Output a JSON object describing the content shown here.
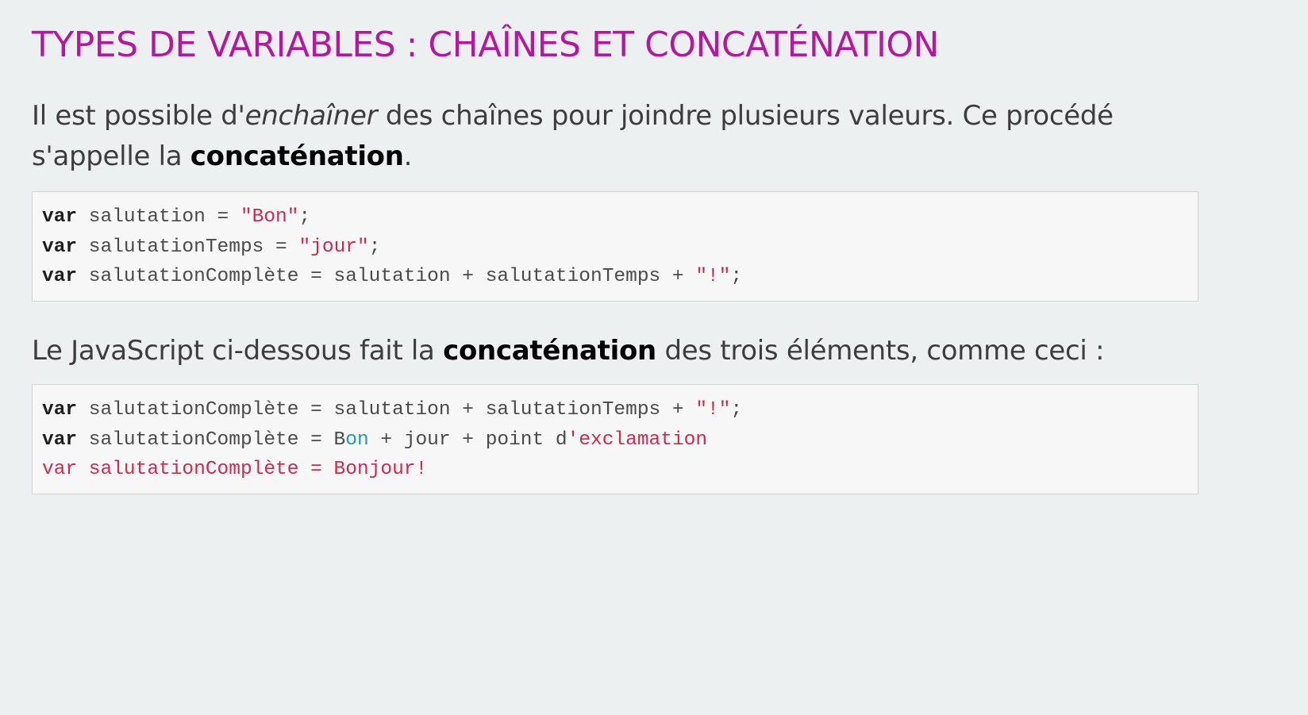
{
  "title": "TYPES DE VARIABLES : CHAÎNES ET CONCATÉNATION",
  "paragraph1": {
    "part1": "Il est possible d'",
    "emphasis": "enchaîner",
    "part2": " des chaînes pour joindre plusieurs valeurs. Ce procédé s'appelle la ",
    "strong": "concaténation",
    "part3": "."
  },
  "code1": {
    "line1": {
      "kw": "var",
      "text": " salutation = ",
      "str": "\"Bon\"",
      "end": ";"
    },
    "line2": {
      "kw": "var",
      "text": " salutationTemps = ",
      "str": "\"jour\"",
      "end": ";"
    },
    "line3": {
      "kw": "var",
      "text": " salutationComplète = salutation + salutationTemps + ",
      "str": "\"!\"",
      "end": ";"
    }
  },
  "paragraph2": {
    "part1": "Le JavaScript ci-dessous fait la ",
    "strong": "concaténation",
    "part2": " des trois éléments, comme ceci :"
  },
  "code2": {
    "line1": {
      "kw": "var",
      "text": " salutationComplète = salutation + salutationTemps + ",
      "str": "\"!\"",
      "end": ";"
    },
    "line2": {
      "kw": "var",
      "text_a": " salutationComplète = B",
      "teal": "on",
      "text_b": " + jour + point d",
      "pink": "'exclamation"
    },
    "line3": "var salutationComplète = Bonjour!"
  }
}
